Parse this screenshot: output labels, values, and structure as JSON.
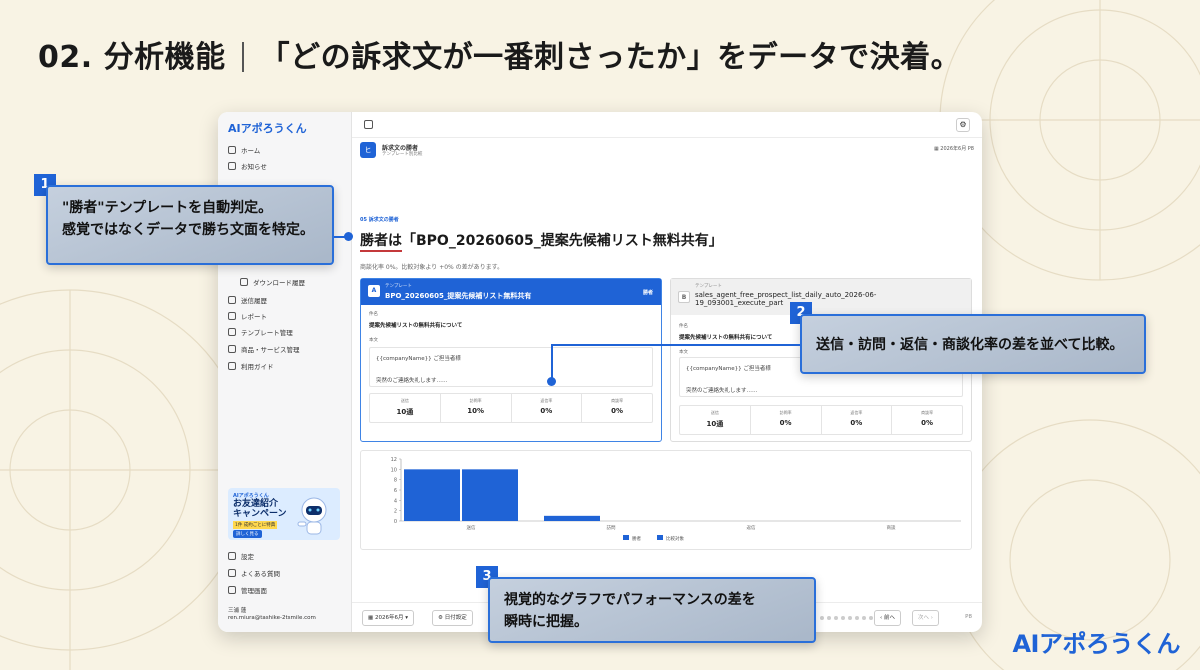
{
  "slide": {
    "title_left": "02. 分析機能",
    "title_right": "「どの訴求文が一番刺さったか」をデータで決着。",
    "brand": "AIアポろうくん"
  },
  "sidebar": {
    "logo": "AIアポろうくん",
    "items": [
      {
        "label": "ホーム",
        "icon": "home-icon"
      },
      {
        "label": "お知らせ",
        "icon": "megaphone-icon"
      },
      {
        "label": "ダウンロード履歴",
        "icon": "download-icon"
      },
      {
        "label": "送信履歴",
        "icon": "history-icon"
      },
      {
        "label": "レポート",
        "icon": "chart-icon"
      },
      {
        "label": "テンプレート管理",
        "icon": "template-icon"
      },
      {
        "label": "商品・サービス管理",
        "icon": "box-icon"
      },
      {
        "label": "利用ガイド",
        "icon": "book-icon"
      }
    ],
    "banner": {
      "brand": "AIアポろうくん",
      "title_1": "お友達紹介",
      "title_2": "キャンペーン",
      "sub": "1件 成約ごとに特典",
      "cta": "詳しく見る"
    },
    "bottom_items": [
      {
        "label": "設定",
        "icon": "gear-icon"
      },
      {
        "label": "よくある質問",
        "icon": "help-icon"
      },
      {
        "label": "管理画面",
        "icon": "shield-icon"
      }
    ],
    "user": {
      "name": "三浦 蓮",
      "email": "ren.miura@tashike-2tsmile.com"
    }
  },
  "header": {
    "title": "訴求文の勝者",
    "subtitle": "テンプレート別比較",
    "date": "2026年6月",
    "page": "P8"
  },
  "result": {
    "section_label": "05 訴求文の勝者",
    "winner_text": "勝者は「BPO_20260605_提案先候補リスト無料共有」",
    "summary": "商談化率 0%。比較対象より +0% の差があります。"
  },
  "cards": [
    {
      "tag": "テンプレート",
      "name": "BPO_20260605_提案先候補リスト無料共有",
      "badge": "勝者",
      "avatar": "A",
      "subject_label": "件名",
      "subject": "提案先候補リストの無料共有について",
      "body_label": "本文",
      "body_line1": "{{companyName}} ご担当者様",
      "body_line2": "突然のご連絡失礼します……",
      "stats": [
        {
          "label": "送信",
          "value": "10通"
        },
        {
          "label": "訪問率",
          "value": "10%"
        },
        {
          "label": "返信率",
          "value": "0%"
        },
        {
          "label": "商談率",
          "value": "0%"
        }
      ]
    },
    {
      "tag": "テンプレート",
      "name": "sales_agent_free_prospect_list_daily_auto_2026-06-19_093001_execute_part",
      "badge": "",
      "avatar": "B",
      "subject_label": "件名",
      "subject": "提案先候補リストの無料共有について",
      "body_label": "本文",
      "body_line1": "{{companyName}} ご担当者様",
      "body_line2": "突然のご連絡失礼します……",
      "stats": [
        {
          "label": "送信",
          "value": "10通"
        },
        {
          "label": "訪問率",
          "value": "0%"
        },
        {
          "label": "返信率",
          "value": "0%"
        },
        {
          "label": "商談率",
          "value": "0%"
        }
      ]
    }
  ],
  "chart_data": {
    "type": "bar",
    "categories": [
      "送信",
      "訪問",
      "返信",
      "商談"
    ],
    "series": [
      {
        "name": "勝者",
        "values": [
          10,
          1,
          0,
          0
        ]
      },
      {
        "name": "比較対象",
        "values": [
          10,
          0,
          0,
          0
        ]
      }
    ],
    "yticks": [
      "0",
      "2",
      "4",
      "6",
      "8",
      "10",
      "12"
    ],
    "ylim": [
      0,
      12
    ],
    "legend": "bottom",
    "colors": [
      "#1f63d6",
      "#1f63d6"
    ]
  },
  "bottombar": {
    "month": "2026年6月",
    "period_btn": "日付設定",
    "prev": "前へ",
    "next": "次へ",
    "page": "P8"
  },
  "callouts": [
    {
      "num": "1",
      "line1": "\"勝者\"テンプレートを自動判定。",
      "line2": "感覚ではなくデータで勝ち文面を特定。"
    },
    {
      "num": "2",
      "line1": "送信・訪問・返信・商談化率の差を並べて比較。"
    },
    {
      "num": "3",
      "line1": "視覚的なグラフでパフォーマンスの差を",
      "line2": "瞬時に把握。"
    }
  ],
  "colors": {
    "accent": "#1f63d6",
    "background": "#f8f3e4"
  }
}
